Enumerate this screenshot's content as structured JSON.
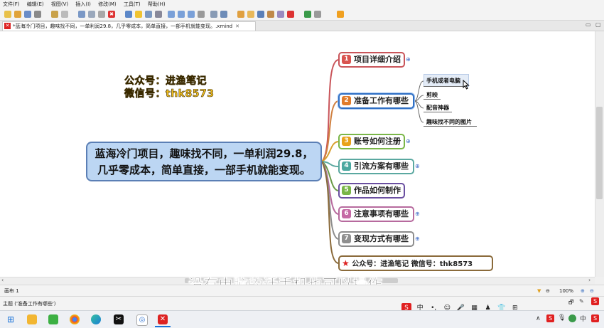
{
  "menubar": {
    "items": [
      {
        "label": "文件(F)"
      },
      {
        "label": "编辑(E)"
      },
      {
        "label": "视图(V)"
      },
      {
        "label": "插入(I)"
      },
      {
        "label": "修改(M)"
      },
      {
        "label": "工具(T)"
      },
      {
        "label": "帮助(H)"
      }
    ]
  },
  "toolbar": {
    "icons": [
      "new-icon",
      "open-icon",
      "save-icon",
      "print-icon",
      "undo-icon",
      "redo-icon",
      "cut-icon",
      "copy-icon",
      "paste-icon",
      "delete-icon",
      "topic-icon",
      "idea-icon",
      "outline-icon",
      "layout-icon",
      "subtopic-icon",
      "floating-topic-icon",
      "relationship-icon",
      "link-icon",
      "image-icon",
      "boundary-icon",
      "summary-icon",
      "marker-icon",
      "label-icon",
      "note-icon",
      "attachment-icon",
      "drill-down-icon",
      "drill-up-icon",
      "home-icon"
    ]
  },
  "tab": {
    "title": "*蓝海冷门项目，趣味找不同，一单利润29.8，几乎零成本，简单直接，一部手机就能变现。.xmind"
  },
  "map": {
    "central_line1": "蓝海冷门项目，趣味找不同，一单利润29.8，",
    "central_line2": "几乎零成本，简单直接，一部手机就能变现。",
    "watermark_line1": "公众号：进渔笔记",
    "watermark_line2": "微信号：thk8573",
    "topics": [
      {
        "num": "1",
        "label": "项目详细介绍",
        "color": "#d9534f"
      },
      {
        "num": "2",
        "label": "准备工作有哪些",
        "color": "#e07b2a"
      },
      {
        "num": "3",
        "label": "账号如何注册",
        "color": "#e8a21b"
      },
      {
        "num": "4",
        "label": "引流方案有哪些",
        "color": "#4aa8a0"
      },
      {
        "num": "5",
        "label": "作品如何制作",
        "color": "#7ab648"
      },
      {
        "num": "6",
        "label": "注意事项有哪些",
        "color": "#c56aa5"
      },
      {
        "num": "7",
        "label": "变现方式有哪些",
        "color": "#8f8f8f"
      }
    ],
    "contact": "公众号：进渔笔记     微信号：thk8573",
    "subtopics": [
      "手机或者电脑",
      "剪映",
      "配音神器",
      "趣味找不同的图片"
    ]
  },
  "caption": "没有电脑的话手机也可以操作",
  "status": {
    "sheet": "画布 1",
    "selection": "主题 ('准备工作有哪些')",
    "zoom": "100%"
  },
  "ime": [
    "中",
    "•,",
    "☺",
    "🎤",
    "▦",
    "♟",
    "👕",
    "⊞"
  ],
  "taskbar": {
    "icons": [
      "windows-icon",
      "file-explorer-icon",
      "wechat-icon",
      "chrome-icon",
      "edge-icon",
      "capcut-icon",
      "app-icon",
      "xmind-icon"
    ]
  },
  "tray": {
    "icons": [
      "chevron-up-icon",
      "ime-icon",
      "microphone-icon",
      "speaker-icon",
      "input-icon",
      "notification-icon"
    ]
  }
}
